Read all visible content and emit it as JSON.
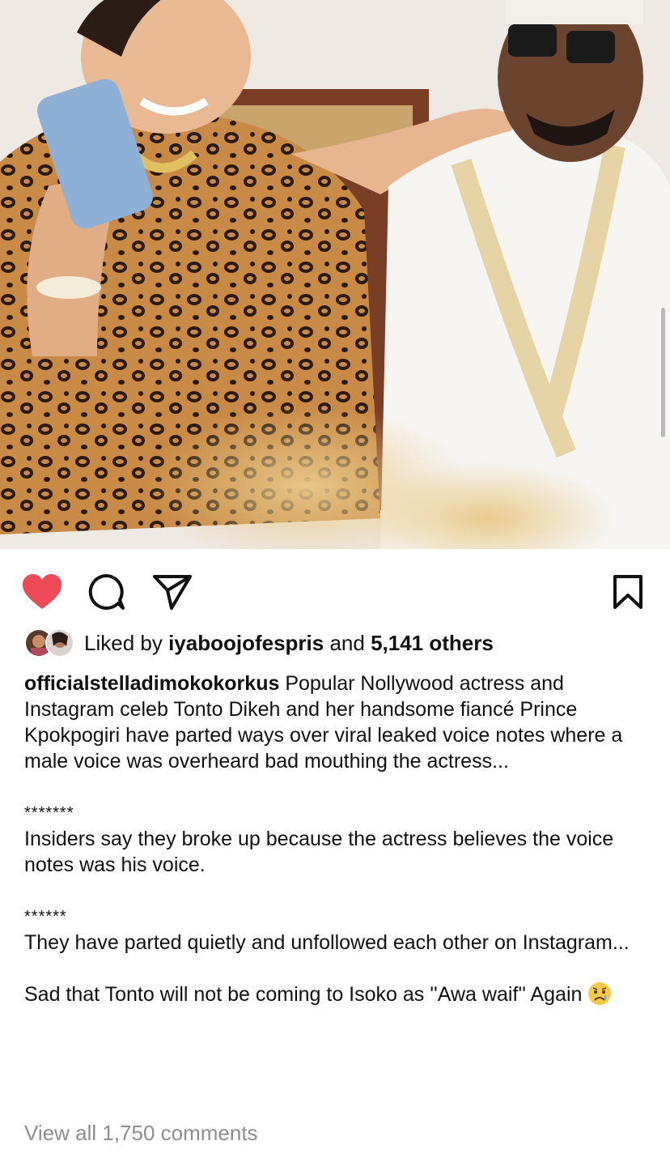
{
  "post": {
    "photo_alt": "Woman in leopard print outfit holding a phone beside a smiling man in white traditional attire with coral beads"
  },
  "actions": {
    "like": "heart-icon",
    "comment": "comment-icon",
    "share": "send-icon",
    "save": "bookmark-icon",
    "liked": true,
    "like_color": "#ed4956"
  },
  "likes": {
    "prefix": "Liked by ",
    "user": "iyaboojofespris",
    "middle": " and ",
    "count": "5,141 others"
  },
  "caption": {
    "username": "officialstelladimokokorkus",
    "p1": " Popular Nollywood actress and Instagram celeb Tonto Dikeh and her handsome fiancé Prince Kpokpogiri have parted ways over viral leaked voice notes where a male voice was overheard bad mouthing the actress...",
    "sep1": "*******",
    "p2": "Insiders say they broke up because the actress believes the voice notes was his voice.",
    "sep2": "******",
    "p3": "They have parted quietly and unfollowed each other on Instagram...",
    "p4": "Sad that Tonto will not be coming to Isoko as ''Awa waif'' Again",
    "emoji": "sad-face-emoji"
  },
  "comments": {
    "label": "View all 1,750 comments"
  }
}
